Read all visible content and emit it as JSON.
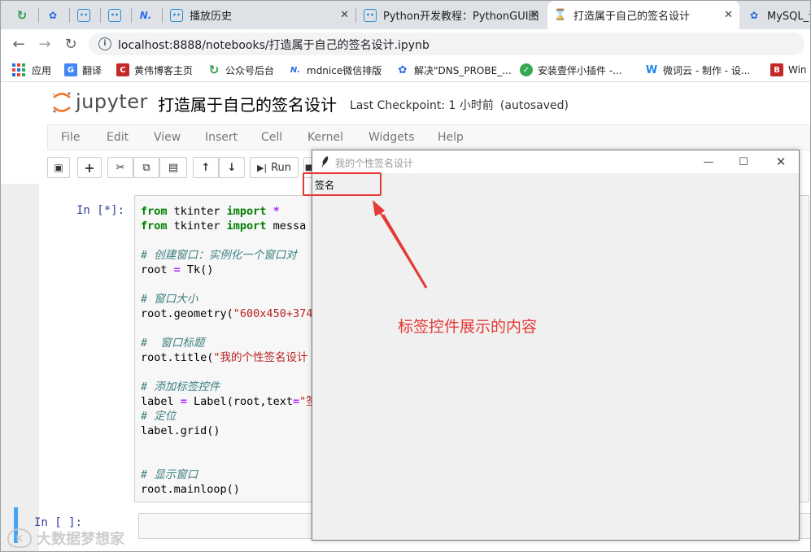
{
  "tabs": [
    {
      "title": "",
      "icon": "wechat-green-icon",
      "color": "#2e9d47"
    },
    {
      "title": "",
      "icon": "baidu-paw-icon",
      "color": "#2a6ae9"
    },
    {
      "title": "",
      "icon": "bilibili-tv-icon",
      "color": "#2a8fd6"
    },
    {
      "title": "",
      "icon": "bilibili-tv-icon",
      "color": "#2a8fd6"
    },
    {
      "title": "",
      "icon": "mdnice-icon",
      "color": "#2a6ae9"
    },
    {
      "title": "播放历史",
      "icon": "bilibili-tv-icon",
      "color": "#2a8fd6"
    },
    {
      "title": "Python开发教程：PythonGUI图",
      "icon": "bilibili-tv-icon",
      "color": "#2a8fd6"
    },
    {
      "title": "打造属于自己的签名设计",
      "icon": "hourglass-icon",
      "color": "#f57c00",
      "active": true
    },
    {
      "title": "MySQL_语",
      "icon": "baidu-paw-icon",
      "color": "#2a6ae9"
    }
  ],
  "address": {
    "url": "localhost:8888/notebooks/打造属于自己的签名设计.ipynb"
  },
  "bookmarks": [
    {
      "label": "应用"
    },
    {
      "label": "翻译"
    },
    {
      "label": "黄伟博客主页"
    },
    {
      "label": "公众号后台"
    },
    {
      "label": "mdnice微信排版"
    },
    {
      "label": "解决\"DNS_PROBE_..."
    },
    {
      "label": "安装壹伴小插件 -..."
    },
    {
      "label": "微词云 - 制作 - 设..."
    },
    {
      "label": "Win"
    }
  ],
  "jupyter": {
    "logo_text": "jupyter",
    "notebook_title": "打造属于自己的签名设计",
    "checkpoint": "Last Checkpoint: 1 小时前",
    "autosaved": "(autosaved)"
  },
  "menu": [
    "File",
    "Edit",
    "View",
    "Insert",
    "Cell",
    "Kernel",
    "Widgets",
    "Help"
  ],
  "toolbar": {
    "run_label": "Run"
  },
  "cells": {
    "cell1_prompt": "In [*]:",
    "cell2_prompt": "In [ ]:"
  },
  "tk": {
    "title": "我的个性签名设计",
    "label_text": "签名"
  },
  "annotation": {
    "text": "标签控件展示的内容"
  },
  "watermark": {
    "text": "大数据梦想家"
  },
  "colors": {
    "accent": "#42a5f5",
    "annotation": "#e53935",
    "jupyter_orange": "#f37626"
  }
}
